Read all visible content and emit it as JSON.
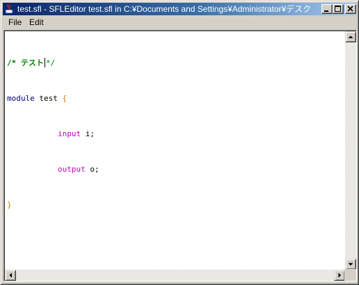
{
  "window": {
    "title": "test.sfl - SFLEditor test.sfl in C:¥Documents and Settings¥Administrator¥デスクトップ"
  },
  "menu": {
    "items": [
      {
        "label": "File"
      },
      {
        "label": "Edit"
      }
    ]
  },
  "editor": {
    "line1": {
      "comment_start": "/* テスト",
      "comment_end": "*/"
    },
    "line2": {
      "keyword": "module",
      "name": "test",
      "brace_open": "{"
    },
    "line3": {
      "keyword": "input",
      "name": "i;"
    },
    "line4": {
      "keyword": "output",
      "name": "o;"
    },
    "line5": {
      "brace_close": "}"
    }
  },
  "colors": {
    "comment": "#008000",
    "keyword": "#000080",
    "port_keyword": "#c000c0",
    "brace": "#c08000",
    "titlebar_start": "#0a246a"
  }
}
